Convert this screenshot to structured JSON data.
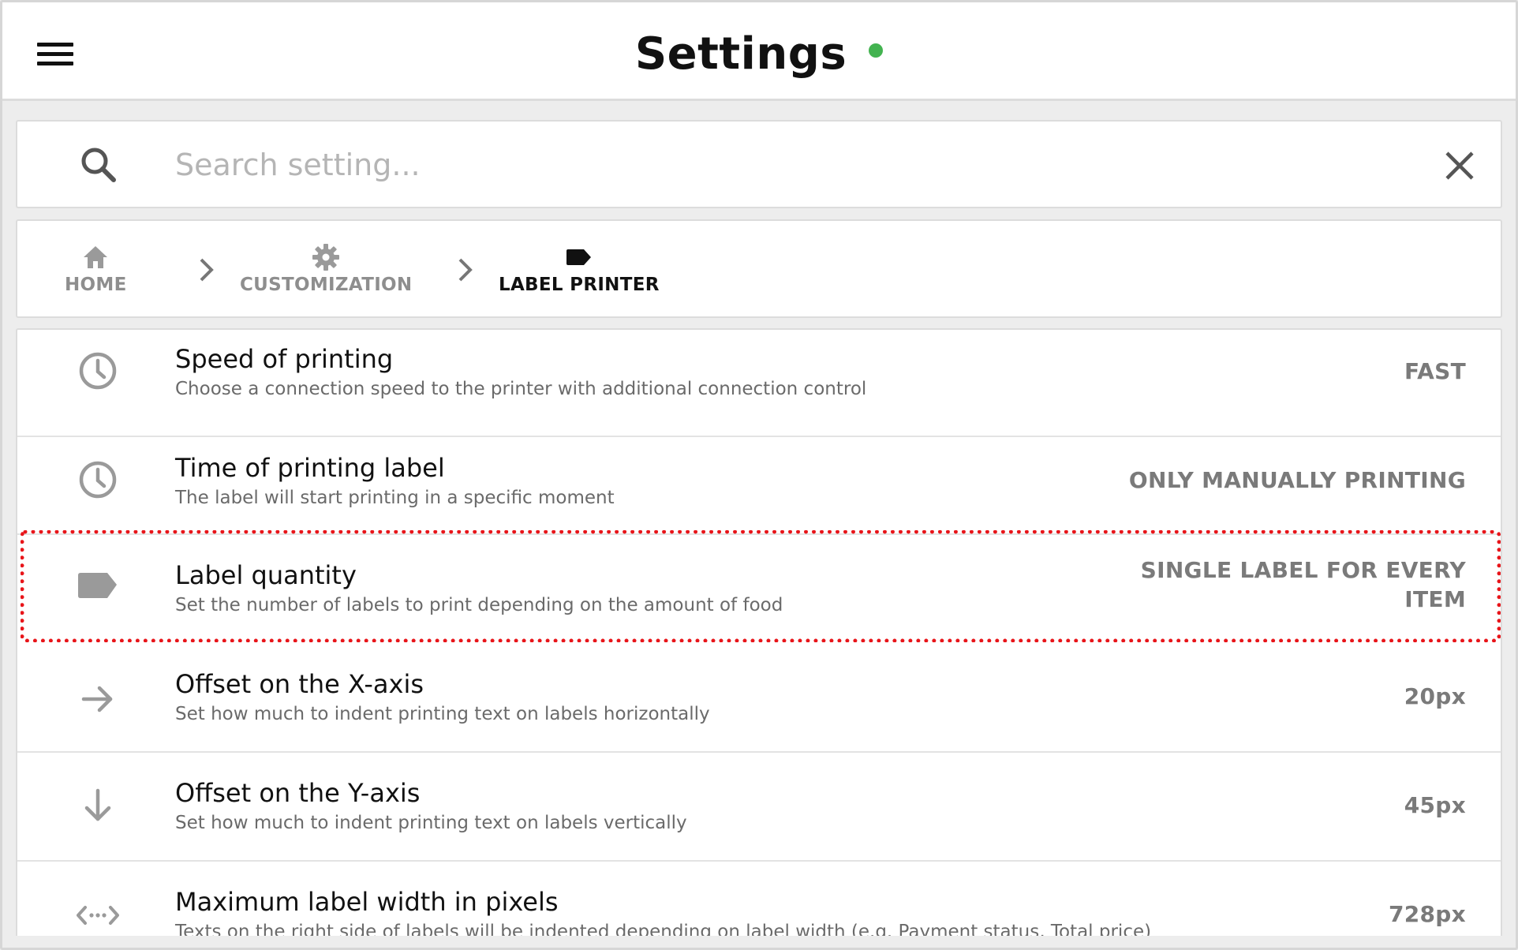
{
  "header": {
    "title": "Settings",
    "status_color": "#43b350",
    "menu_icon": "hamburger-menu-icon"
  },
  "search": {
    "placeholder": "Search setting...",
    "value": "",
    "search_icon": "search-icon",
    "clear_icon": "close-icon"
  },
  "breadcrumb": [
    {
      "label": "HOME",
      "icon": "home-icon",
      "active": false
    },
    {
      "label": "CUSTOMIZATION",
      "icon": "gear-icon",
      "active": false
    },
    {
      "label": "LABEL PRINTER",
      "icon": "label-tag-icon",
      "active": true
    }
  ],
  "settings": [
    {
      "title": "Speed of printing",
      "description": "Choose a connection speed to the printer with additional connection control",
      "value": "FAST",
      "icon": "clock-icon"
    },
    {
      "title": "Time of printing label",
      "description": "The label will start printing in a specific moment",
      "value": "ONLY MANUALLY PRINTING",
      "icon": "clock-icon"
    },
    {
      "title": "Label quantity",
      "description": "Set the number of labels to print depending on the amount of food",
      "value_line1": "SINGLE LABEL FOR EVERY",
      "value_line2": "ITEM",
      "icon": "label-tag-icon",
      "highlighted": true
    },
    {
      "title": "Offset on the X-axis",
      "description": "Set how much to indent printing text on labels horizontally",
      "value": "20px",
      "icon": "arrow-right-icon"
    },
    {
      "title": "Offset on the Y-axis",
      "description": "Set how much to indent printing text on labels vertically",
      "value": "45px",
      "icon": "arrow-down-icon"
    },
    {
      "title": "Maximum label width in pixels",
      "description": "Texts on the right side of labels will be indented depending on label width (e.g. Payment status, Total price)",
      "value": "728px",
      "icon": "width-arrows-icon"
    }
  ],
  "colors": {
    "highlight": "#e8151a",
    "muted_text": "#8e8e8e",
    "icon_gray": "#9a9a9a"
  }
}
